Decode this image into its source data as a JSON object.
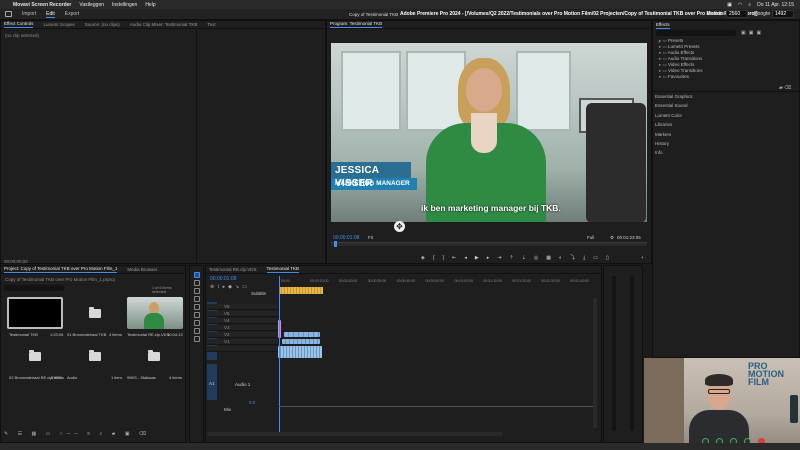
{
  "menubar": {
    "app": "Movavi Screen Recorder",
    "menus": [
      "Vastleggen",
      "Instellingen",
      "Help"
    ],
    "clock": "Do 11 Apr. 12:15"
  },
  "header": {
    "tabs": [
      "Import",
      "Edit",
      "Export"
    ],
    "active_tab": "Edit",
    "title": "Adobe Premiere Pro 2024 - [/Volumes/Q2 2022/Testimonials over Pro Motion Film/02 Projecten/Copy of Testimonial TKB over Pro Motion Film_1.prproj]",
    "width_label": "Breedte",
    "width_value": "2560",
    "height_label": "Hoogte",
    "height_value": "1492"
  },
  "source_panel": {
    "tabs": [
      "Effect Controls",
      "Lumetri Scopes",
      "Source: (no clips)",
      "Audio Clip Mixer: Testimonial TKB",
      "Text"
    ],
    "empty_text": "(no clip selected)",
    "timecode": "00;00;00;00"
  },
  "program_monitor": {
    "tab": "Program: Testimonial TKB",
    "sequence_name": "Copy of Testimonial TKB",
    "lower_third_name": "JESSICA VISSER",
    "lower_third_role": "MARKETING MANAGER",
    "subtitle": "ik ben marketing manager bij TKB.",
    "timecode": "00:00:01:08",
    "fit": "Fit",
    "quality": "Full",
    "duration": "00:01:23:05"
  },
  "effects_panel": {
    "tab": "Effects",
    "folders": [
      "Presets",
      "Lumetri Presets",
      "Audio Effects",
      "Audio Transitions",
      "Video Effects",
      "Video Transitions",
      "Favourites"
    ],
    "sections": [
      "Essential Graphics",
      "Essential Sound",
      "Lumetri Color",
      "Libraries",
      "Markers",
      "History",
      "Info"
    ]
  },
  "project_panel": {
    "tabs": [
      "Project: Copy of Testimonial TKB over Pro Motion Film_1",
      "Media Browser"
    ],
    "path": "Copy of Testimonial TKB over Pro Motion Film_1.prproj",
    "selection": "1 of 6 items selected",
    "items": [
      {
        "name": "Testimonial TKB",
        "meta": "1:23:05"
      },
      {
        "name": "01 Bronmateriaal TKB",
        "meta": "4 items"
      },
      {
        "name": "Testimonial RE.clp.VDS",
        "meta": "10:04:13"
      },
      {
        "name": "02 Bronmateriaal RE.clp.VDS",
        "meta": "5 items"
      },
      {
        "name": "Audio",
        "meta": "1 item"
      },
      {
        "name": "99KS - Stalkaas",
        "meta": "4 items"
      }
    ]
  },
  "timeline": {
    "tabs": [
      "Testimonial RE.clp.VDS",
      "Testimonial TKB"
    ],
    "timecode": "00:00:01:08",
    "subtitles_label": "Subtitle",
    "video_tracks": [
      "V6",
      "V5",
      "V4",
      "V3",
      "V2",
      "V1"
    ],
    "audio_tracks": [
      "A1",
      "A2",
      "A3"
    ],
    "audio_label": "Audio 1",
    "mix_label": "Mix",
    "mix_value": "0.0",
    "ruler": [
      "00:00",
      "00:00:10:00",
      "00:00:20:00",
      "00:00:30:00",
      "00:00:40:00",
      "00:00:50:00",
      "00:01:00:00",
      "00:01:10:00",
      "00:01:20:00",
      "00:01:30:00",
      "00:01:40:00"
    ]
  },
  "webcam": {
    "logo": "PRO MOTION FILM"
  },
  "colors": {
    "accent": "#3e8ef7",
    "clip_blue": "#8ab4e0",
    "clip_pink": "#d98ad6",
    "subtitle_clip": "#e6b84a",
    "lower_third": "#2180b3"
  }
}
